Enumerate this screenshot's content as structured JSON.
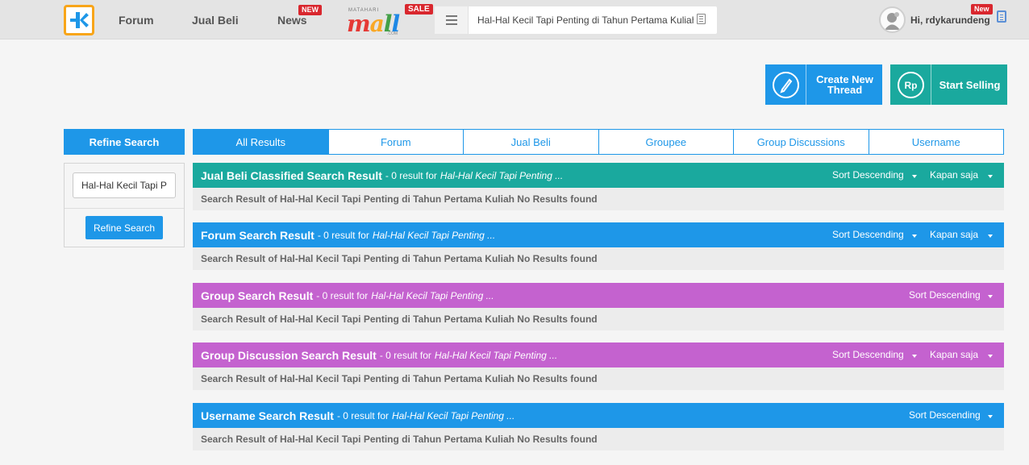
{
  "navbar": {
    "forum_label": "Forum",
    "jualbeli_label": "Jual Beli",
    "news_label": "News",
    "news_badge": "NEW",
    "mall_brand_top": "MATAHARI",
    "mall_brand": "mall",
    "mall_brand_com": ".COM",
    "mall_badge": "SALE",
    "search_value": "Hal-Hal Kecil Tapi Penting di Tahun Pertama Kuliah",
    "username": "Hi, rdykarundeng",
    "user_badge": "New"
  },
  "actions": {
    "create_thread_label": "Create New Thread",
    "start_selling_label": "Start Selling",
    "rp_symbol": "Rp"
  },
  "refine": {
    "header": "Refine Search",
    "input_value": "Hal-Hal Kecil Tapi Penting di Tahun Pertama Kuliah",
    "button_label": "Refine Search"
  },
  "tabs": [
    "All Results",
    "Forum",
    "Jual Beli",
    "Groupee",
    "Group Discussions",
    "Username"
  ],
  "results": [
    {
      "title": "Jual Beli Classified Search Result",
      "sub": "- 0 result for",
      "query": "Hal-Hal Kecil Tapi Penting ...",
      "sort": "Sort Descending",
      "time": "Kapan saja",
      "color": "#1aa99e",
      "body": "Search Result of Hal-Hal Kecil Tapi Penting di Tahun Pertama Kuliah No Results found"
    },
    {
      "title": "Forum Search Result",
      "sub": "- 0 result for",
      "query": "Hal-Hal Kecil Tapi Penting ...",
      "sort": "Sort Descending",
      "time": "Kapan saja",
      "color": "#1e97e8",
      "body": "Search Result of Hal-Hal Kecil Tapi Penting di Tahun Pertama Kuliah No Results found"
    },
    {
      "title": "Group Search Result",
      "sub": "- 0 result for",
      "query": "Hal-Hal Kecil Tapi Penting ...",
      "sort": "Sort Descending",
      "time": "",
      "color": "#c462cf",
      "body": "Search Result of Hal-Hal Kecil Tapi Penting di Tahun Pertama Kuliah No Results found"
    },
    {
      "title": "Group Discussion Search Result",
      "sub": "- 0 result for",
      "query": "Hal-Hal Kecil Tapi Penting ...",
      "sort": "Sort Descending",
      "time": "Kapan saja",
      "color": "#c462cf",
      "body": "Search Result of Hal-Hal Kecil Tapi Penting di Tahun Pertama Kuliah No Results found"
    },
    {
      "title": "Username Search Result",
      "sub": "- 0 result for",
      "query": "Hal-Hal Kecil Tapi Penting ...",
      "sort": "Sort Descending",
      "time": "",
      "color": "#1e97e8",
      "body": "Search Result of Hal-Hal Kecil Tapi Penting di Tahun Pertama Kuliah No Results found"
    }
  ],
  "colors": {
    "brand_blue": "#1e97e8",
    "teal": "#1aa99e",
    "purple": "#c462cf",
    "logo_orange": "#f8a519",
    "badge_red": "#d9272e"
  }
}
